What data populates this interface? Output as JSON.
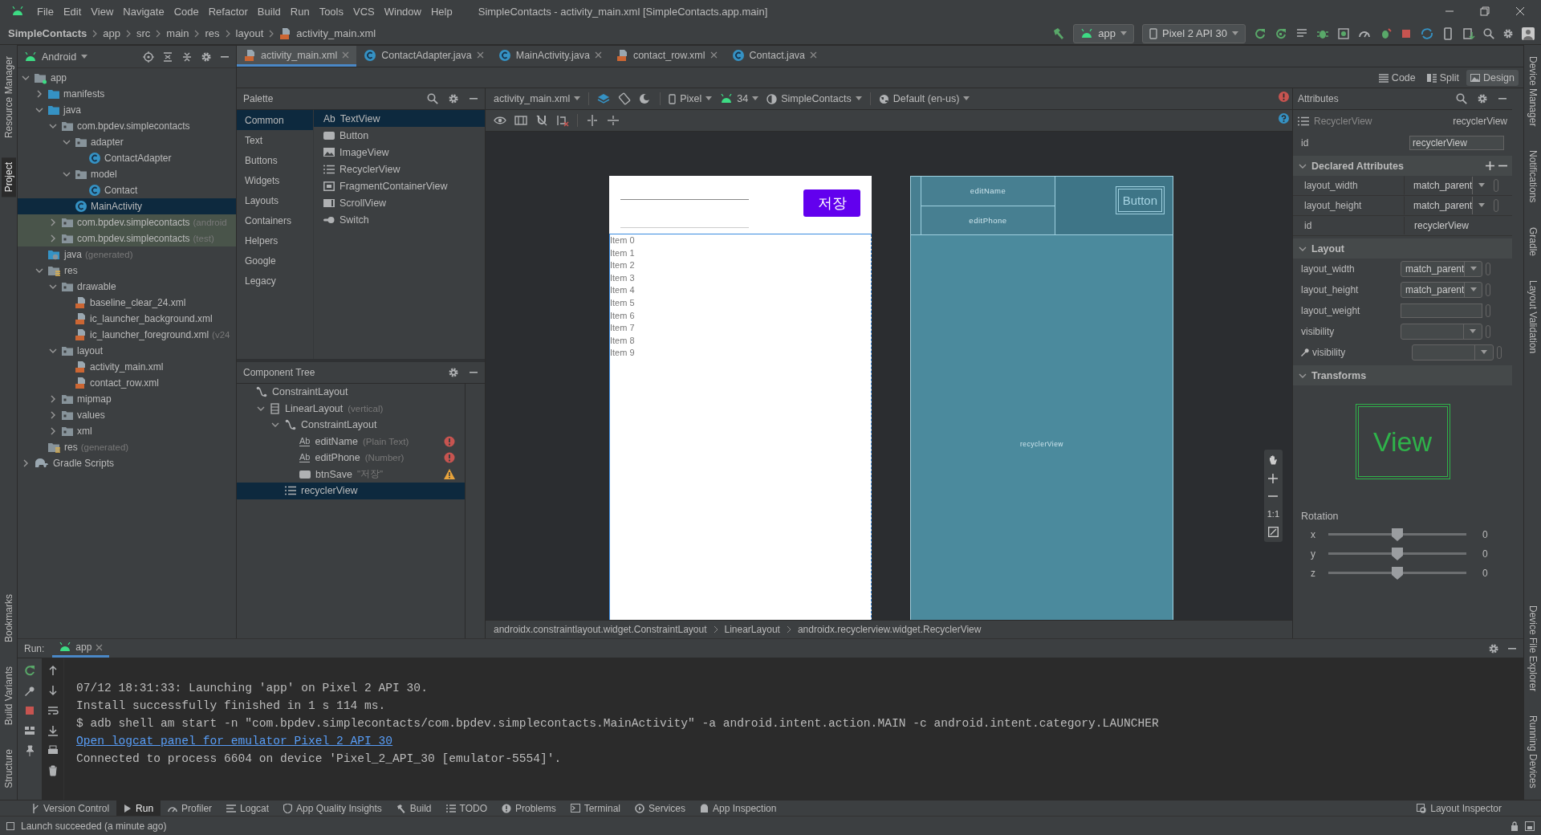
{
  "menu": [
    "File",
    "Edit",
    "View",
    "Navigate",
    "Code",
    "Refactor",
    "Build",
    "Run",
    "Tools",
    "VCS",
    "Window",
    "Help"
  ],
  "window_title": "SimpleContacts - activity_main.xml [SimpleContacts.app.main]",
  "breadcrumb": [
    "SimpleContacts",
    "app",
    "src",
    "main",
    "res",
    "layout",
    "activity_main.xml"
  ],
  "run_config": "app",
  "device": "Pixel 2 API 30",
  "left_stripe": {
    "top": [
      {
        "label": "Resource Manager",
        "selected": false
      },
      {
        "label": "Project",
        "selected": true
      }
    ],
    "bottom": [
      {
        "label": "Bookmarks",
        "selected": false
      },
      {
        "label": "Build Variants",
        "selected": false
      },
      {
        "label": "Structure",
        "selected": false
      }
    ]
  },
  "right_stripe": {
    "top": [
      {
        "label": "Device Manager",
        "selected": false
      },
      {
        "label": "Notifications",
        "selected": false
      },
      {
        "label": "Gradle",
        "selected": false
      },
      {
        "label": "Layout Validation",
        "selected": false
      }
    ],
    "bottom": [
      {
        "label": "Device File Explorer",
        "selected": false
      },
      {
        "label": "Running Devices",
        "selected": false
      }
    ]
  },
  "project_view": "Android",
  "project_tree": [
    {
      "label": "app",
      "kind": "module",
      "expanded": true,
      "selected": false,
      "children": [
        {
          "label": "manifests",
          "kind": "source_folder",
          "expanded": false,
          "selected": false
        },
        {
          "label": "java",
          "kind": "source_folder",
          "expanded": true,
          "selected": false,
          "children": [
            {
              "label": "com.bpdev.simplecontacts",
              "kind": "package",
              "expanded": true,
              "selected": false,
              "children": [
                {
                  "label": "adapter",
                  "kind": "package",
                  "expanded": true,
                  "selected": false,
                  "children": [
                    {
                      "label": "ContactAdapter",
                      "kind": "class",
                      "selected": false
                    }
                  ]
                },
                {
                  "label": "model",
                  "kind": "package",
                  "expanded": true,
                  "selected": false,
                  "children": [
                    {
                      "label": "Contact",
                      "kind": "class",
                      "selected": false
                    }
                  ]
                },
                {
                  "label": "MainActivity",
                  "kind": "class",
                  "selected": true
                }
              ]
            },
            {
              "label": "com.bpdev.simplecontacts",
              "suffix": "(android",
              "kind": "test_package",
              "expanded": false,
              "selected": false
            },
            {
              "label": "com.bpdev.simplecontacts",
              "suffix": "(test)",
              "kind": "test_package",
              "expanded": false,
              "selected": false
            }
          ]
        },
        {
          "label": "java",
          "suffix": "(generated)",
          "kind": "generated",
          "selected": false
        },
        {
          "label": "res",
          "kind": "resources",
          "expanded": true,
          "selected": false,
          "children": [
            {
              "label": "drawable",
              "kind": "package",
              "expanded": true,
              "selected": false,
              "children": [
                {
                  "label": "baseline_clear_24.xml",
                  "kind": "xml",
                  "selected": false
                },
                {
                  "label": "ic_launcher_background.xml",
                  "kind": "xml",
                  "selected": false
                },
                {
                  "label": "ic_launcher_foreground.xml",
                  "suffix": "(v24",
                  "kind": "xml",
                  "selected": false
                }
              ]
            },
            {
              "label": "layout",
              "kind": "package",
              "expanded": true,
              "selected": false,
              "children": [
                {
                  "label": "activity_main.xml",
                  "kind": "xml",
                  "selected": false
                },
                {
                  "label": "contact_row.xml",
                  "kind": "xml",
                  "selected": false
                }
              ]
            },
            {
              "label": "mipmap",
              "kind": "package",
              "expanded": false,
              "selected": false
            },
            {
              "label": "values",
              "kind": "package",
              "expanded": false,
              "selected": false
            },
            {
              "label": "xml",
              "kind": "package",
              "expanded": false,
              "selected": false
            }
          ]
        },
        {
          "label": "res",
          "suffix": "(generated)",
          "kind": "resources",
          "selected": false
        }
      ]
    },
    {
      "label": "Gradle Scripts",
      "kind": "gradle",
      "expanded": false,
      "selected": false
    }
  ],
  "editor_tabs": [
    {
      "label": "activity_main.xml",
      "kind": "xml",
      "selected": true
    },
    {
      "label": "ContactAdapter.java",
      "kind": "class",
      "selected": false
    },
    {
      "label": "MainActivity.java",
      "kind": "class",
      "selected": false
    },
    {
      "label": "contact_row.xml",
      "kind": "xml",
      "selected": false
    },
    {
      "label": "Contact.java",
      "kind": "class",
      "selected": false
    }
  ],
  "view_modes": [
    {
      "label": "Code",
      "kind": "code",
      "selected": false
    },
    {
      "label": "Split",
      "kind": "split",
      "selected": false
    },
    {
      "label": "Design",
      "kind": "design",
      "selected": true
    }
  ],
  "palette": {
    "title": "Palette",
    "categories": [
      {
        "label": "Common",
        "selected": true
      },
      {
        "label": "Text",
        "selected": false
      },
      {
        "label": "Buttons",
        "selected": false
      },
      {
        "label": "Widgets",
        "selected": false
      },
      {
        "label": "Layouts",
        "selected": false
      },
      {
        "label": "Containers",
        "selected": false
      },
      {
        "label": "Helpers",
        "selected": false
      },
      {
        "label": "Google",
        "selected": false
      },
      {
        "label": "Legacy",
        "selected": false
      }
    ],
    "items": [
      {
        "label": "TextView",
        "kind": "text",
        "icon_text": "Ab",
        "selected": true
      },
      {
        "label": "Button",
        "kind": "button",
        "selected": false
      },
      {
        "label": "ImageView",
        "kind": "image",
        "selected": false
      },
      {
        "label": "RecyclerView",
        "kind": "list",
        "selected": false
      },
      {
        "label": "FragmentContainerView",
        "kind": "fragment",
        "selected": false
      },
      {
        "label": "ScrollView",
        "kind": "scroll",
        "selected": false
      },
      {
        "label": "Switch",
        "kind": "switch",
        "selected": false
      }
    ]
  },
  "component_tree": {
    "title": "Component Tree",
    "nodes": [
      {
        "label": "ConstraintLayout",
        "kind": "constraint",
        "error": false,
        "warning": false,
        "selected": false,
        "children": [
          {
            "label": "LinearLayout",
            "hint": "(vertical)",
            "kind": "linear",
            "expanded": true,
            "error": false,
            "warning": false,
            "selected": false,
            "children": [
              {
                "label": "ConstraintLayout",
                "kind": "constraint",
                "expanded": true,
                "error": false,
                "warning": false,
                "selected": false,
                "children": [
                  {
                    "label": "editName",
                    "hint": "(Plain Text)",
                    "kind": "text",
                    "icon_text": "Ab",
                    "error": true,
                    "warning": false,
                    "selected": false
                  },
                  {
                    "label": "editPhone",
                    "hint": "(Number)",
                    "kind": "text",
                    "icon_text": "Ab",
                    "error": true,
                    "warning": false,
                    "selected": false
                  },
                  {
                    "label": "btnSave",
                    "hint": "\"저장\"",
                    "kind": "button",
                    "error": false,
                    "warning": true,
                    "selected": false
                  }
                ]
              },
              {
                "label": "recyclerView",
                "kind": "list",
                "error": false,
                "warning": false,
                "selected": true
              }
            ]
          }
        ]
      }
    ]
  },
  "design": {
    "toolbar": {
      "file": "activity_main.xml",
      "device": "Pixel",
      "api": "34",
      "theme": "SimpleContacts",
      "locale": "Default (en-us)"
    },
    "preview": {
      "button": "저장",
      "items": [
        "Item 0",
        "Item 1",
        "Item 2",
        "Item 3",
        "Item 4",
        "Item 5",
        "Item 6",
        "Item 7",
        "Item 8",
        "Item 9"
      ]
    },
    "blueprint": {
      "fields": [
        "editName",
        "editPhone"
      ],
      "button": "Button",
      "list": "recyclerView"
    },
    "zoom_reset": "1:1",
    "path": [
      "androidx.constraintlayout.widget.ConstraintLayout",
      "LinearLayout",
      "androidx.recyclerview.widget.RecyclerView"
    ]
  },
  "attributes": {
    "title": "Attributes",
    "class_name": "RecyclerView",
    "id_name": "recyclerView",
    "id_field": {
      "label": "id",
      "value": "recyclerView"
    },
    "sections": [
      {
        "title": "Declared Attributes",
        "kind": "declared",
        "expanded": true,
        "rows": [
          {
            "label": "layout_width",
            "value": "match_parent",
            "kind": "dropdown",
            "tools": false
          },
          {
            "label": "layout_height",
            "value": "match_parent",
            "kind": "dropdown",
            "tools": false
          },
          {
            "label": "id",
            "value": "recyclerView",
            "kind": "text",
            "tools": false
          }
        ]
      },
      {
        "title": "Layout",
        "kind": "layout",
        "expanded": true,
        "rows": [
          {
            "label": "layout_width",
            "value": "match_parent",
            "kind": "dropdown",
            "tools": false
          },
          {
            "label": "layout_height",
            "value": "match_parent",
            "kind": "dropdown",
            "tools": false
          },
          {
            "label": "layout_weight",
            "kind": "field",
            "tools": false
          },
          {
            "label": "visibility",
            "kind": "dropdown",
            "tools": false
          },
          {
            "label": "visibility",
            "kind": "dropdown",
            "tools": true
          }
        ]
      },
      {
        "title": "Transforms",
        "kind": "transforms",
        "expanded": true,
        "preview": "View",
        "rotation_label": "Rotation",
        "sliders": [
          {
            "axis": "x",
            "level": 0.5,
            "reading": "0"
          },
          {
            "axis": "y",
            "level": 0.5,
            "reading": "0"
          },
          {
            "axis": "z",
            "level": 0.5,
            "reading": "0"
          }
        ]
      }
    ]
  },
  "run": {
    "title": "Run:",
    "tab": "app",
    "lines": [
      {
        "kind": "plain",
        "text": "07/12 18:31:33: Launching 'app' on Pixel 2 API 30."
      },
      {
        "kind": "plain",
        "text": "Install successfully finished in 1 s 114 ms."
      },
      {
        "kind": "plain",
        "text": "$ adb shell am start -n \"com.bpdev.simplecontacts/com.bpdev.simplecontacts.MainActivity\" -a android.intent.action.MAIN -c android.intent.category.LAUNCHER"
      },
      {
        "kind": "link",
        "text": "Open logcat panel for emulator Pixel 2 API 30"
      },
      {
        "kind": "plain",
        "text": "Connected to process 6604 on device 'Pixel_2_API_30 [emulator-5554]'."
      }
    ]
  },
  "tool_windows": [
    {
      "label": "Version Control",
      "kind": "vcs",
      "selected": false
    },
    {
      "label": "Run",
      "kind": "run",
      "selected": true
    },
    {
      "label": "Profiler",
      "kind": "profiler",
      "selected": false
    },
    {
      "label": "Logcat",
      "kind": "logcat",
      "selected": false
    },
    {
      "label": "App Quality Insights",
      "kind": "insights",
      "selected": false
    },
    {
      "label": "Build",
      "kind": "build",
      "selected": false
    },
    {
      "label": "TODO",
      "kind": "todo",
      "selected": false
    },
    {
      "label": "Problems",
      "kind": "problems",
      "selected": false
    },
    {
      "label": "Terminal",
      "kind": "terminal",
      "selected": false
    },
    {
      "label": "Services",
      "kind": "services",
      "selected": false
    },
    {
      "label": "App Inspection",
      "kind": "inspection",
      "selected": false
    }
  ],
  "tool_windows_right": [
    {
      "label": "Layout Inspector",
      "kind": "inspector",
      "selected": false
    }
  ],
  "status": "Launch succeeded (a minute ago)"
}
